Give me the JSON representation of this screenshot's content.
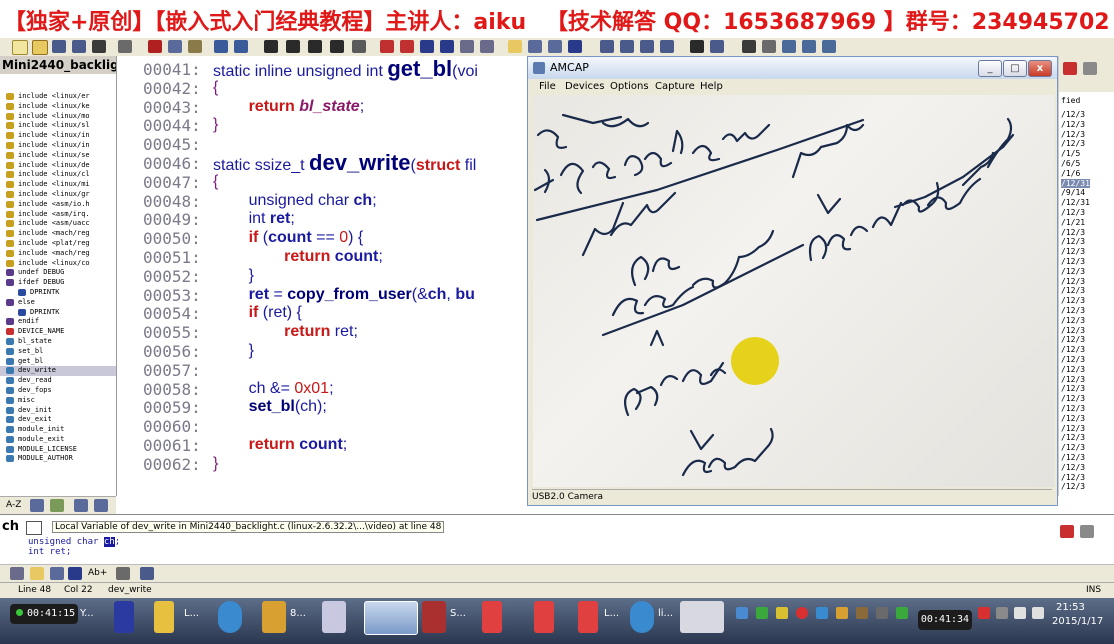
{
  "banner": {
    "left": "【独家+原创】【嵌入式入门经典教程】主讲人：aiku",
    "right": "【技术解答 QQ：1653687969 】群号：234945702"
  },
  "left_panel": {
    "title": "Mini2440_backligh",
    "symbols": [
      "include <linux/er",
      "include <linux/ke",
      "include <linux/mo",
      "include <linux/sl",
      "include <linux/in",
      "include <linux/in",
      "include <linux/se",
      "include <linux/de",
      "include <linux/cl",
      "include <linux/mi",
      "include <linux/gr",
      "include <asm/io.h",
      "include <asm/irq.",
      "include <asm/uacc",
      "include <mach/reg",
      "include <plat/reg",
      "include <mach/reg",
      "include <linux/co",
      "undef DEBUG",
      "ifdef DEBUG",
      "DPRINTK",
      "else",
      "DPRINTK",
      "endif",
      "DEVICE_NAME",
      "bl_state",
      "set_bl",
      "get_bl",
      "dev_write",
      "dev_read",
      "dev_fops",
      "misc",
      "dev_init",
      "dev_exit",
      "module_init",
      "module_exit",
      "MODULE_LICENSE",
      "MODULE_AUTHOR"
    ]
  },
  "code": {
    "lines": [
      {
        "num": "00041:",
        "parts": [
          [
            "kb",
            "static inline unsigned int "
          ],
          [
            "fnb",
            "get_bl"
          ],
          [
            "kb",
            "(voi"
          ]
        ]
      },
      {
        "num": "00042:",
        "parts": [
          [
            "brace",
            "{"
          ]
        ]
      },
      {
        "num": "00043:",
        "parts": [
          [
            "kb",
            "        "
          ],
          [
            "kw",
            "return "
          ],
          [
            "it",
            "bl_state"
          ],
          [
            "kb",
            ";"
          ]
        ]
      },
      {
        "num": "00044:",
        "parts": [
          [
            "brace",
            "}"
          ]
        ]
      },
      {
        "num": "00045:",
        "parts": []
      },
      {
        "num": "00046:",
        "parts": [
          [
            "kb",
            "static ssize_t "
          ],
          [
            "fnb",
            "dev_write"
          ],
          [
            "kb",
            "("
          ],
          [
            "kw",
            "struct "
          ],
          [
            "kb",
            "fil"
          ]
        ]
      },
      {
        "num": "00047:",
        "parts": [
          [
            "brace",
            "{"
          ]
        ]
      },
      {
        "num": "00048:",
        "parts": [
          [
            "kb",
            "        unsigned char "
          ],
          [
            "var",
            "ch"
          ],
          [
            "kb",
            ";"
          ]
        ]
      },
      {
        "num": "00049:",
        "parts": [
          [
            "kb",
            "        int "
          ],
          [
            "var",
            "ret"
          ],
          [
            "kb",
            ";"
          ]
        ]
      },
      {
        "num": "00050:",
        "parts": [
          [
            "kb",
            "        "
          ],
          [
            "kw",
            "if "
          ],
          [
            "kb",
            "("
          ],
          [
            "var",
            "count"
          ],
          [
            "kb",
            " == "
          ],
          [
            "num",
            "0"
          ],
          [
            "kb",
            ") {"
          ]
        ]
      },
      {
        "num": "00051:",
        "parts": [
          [
            "kb",
            "                "
          ],
          [
            "kw",
            "return "
          ],
          [
            "var",
            "count"
          ],
          [
            "kb",
            ";"
          ]
        ]
      },
      {
        "num": "00052:",
        "parts": [
          [
            "kb",
            "        }"
          ]
        ]
      },
      {
        "num": "00053:",
        "parts": [
          [
            "kb",
            "        "
          ],
          [
            "var",
            "ret"
          ],
          [
            "kb",
            " = "
          ],
          [
            "fn",
            "copy_from_user"
          ],
          [
            "kb",
            "(&"
          ],
          [
            "var",
            "ch"
          ],
          [
            "kb",
            ", "
          ],
          [
            "var",
            "bu"
          ]
        ]
      },
      {
        "num": "00054:",
        "parts": [
          [
            "kb",
            "        "
          ],
          [
            "kw",
            "if "
          ],
          [
            "kb",
            "(ret) {"
          ]
        ]
      },
      {
        "num": "00055:",
        "parts": [
          [
            "kb",
            "                "
          ],
          [
            "kw",
            "return "
          ],
          [
            "kb",
            "ret;"
          ]
        ]
      },
      {
        "num": "00056:",
        "parts": [
          [
            "kb",
            "        }"
          ]
        ]
      },
      {
        "num": "00057:",
        "parts": []
      },
      {
        "num": "00058:",
        "parts": [
          [
            "kb",
            "        ch &= "
          ],
          [
            "num",
            "0x01"
          ],
          [
            "kb",
            ";"
          ]
        ]
      },
      {
        "num": "00059:",
        "parts": [
          [
            "kb",
            "        "
          ],
          [
            "fn",
            "set_bl"
          ],
          [
            "kb",
            "(ch);"
          ]
        ]
      },
      {
        "num": "00060:",
        "parts": []
      },
      {
        "num": "00061:",
        "parts": [
          [
            "kb",
            "        "
          ],
          [
            "kw",
            "return "
          ],
          [
            "var",
            "count"
          ],
          [
            "kb",
            ";"
          ]
        ]
      },
      {
        "num": "00062:",
        "parts": [
          [
            "brace",
            "}"
          ]
        ]
      }
    ]
  },
  "amcap": {
    "title": "AMCAP",
    "menu": [
      "File",
      "Devices",
      "Options",
      "Capture",
      "Help"
    ],
    "status": "USB2.0 Camera",
    "buttons": {
      "minimize": "_",
      "maximize": "□",
      "close": "x"
    }
  },
  "right_col": {
    "header": "fied",
    "dates": [
      "/12/3",
      "/12/3",
      "/12/3",
      "/12/3",
      "/1/5",
      "/6/5",
      "/1/6",
      "/12/31",
      "/9/14",
      "/12/31",
      "/12/3",
      "/1/21",
      "/12/3",
      "/12/3",
      "/12/3",
      "/12/3",
      "/12/3",
      "/12/3",
      "/12/3",
      "/12/3",
      "/12/3",
      "/12/3",
      "/12/3",
      "/12/3",
      "/12/3",
      "/12/3",
      "/12/3",
      "/12/3",
      "/12/3",
      "/12/3",
      "/12/3",
      "/12/3",
      "/12/3",
      "/12/3",
      "/12/3",
      "/12/3",
      "/12/3",
      "/12/3",
      "/12/3"
    ]
  },
  "info": {
    "symbol": "ch",
    "description": "Local Variable of dev_write in Mini2440_backlight.c (linux-2.6.32.2\\...\\video) at line 48",
    "decl_type": "unsigned char ",
    "decl_name": "ch",
    "decl_end": ";",
    "decl2": "int ret;"
  },
  "statusbar": {
    "line": "Line 48",
    "col": "Col 22",
    "func": "dev_write",
    "mode": "INS"
  },
  "taskbar": {
    "rec_time": "00:41:15",
    "tasks": [
      "Y...",
      "L...",
      "8...",
      "S...",
      "L...",
      "li..."
    ],
    "clock_pill": "00:41:34",
    "time": "21:53",
    "date": "2015/1/17"
  },
  "colors": {
    "banner_red": "#e01818",
    "keyword_red": "#c81818",
    "code_blue": "#1a1aa0",
    "yellow_dot": "#e6d21a"
  }
}
